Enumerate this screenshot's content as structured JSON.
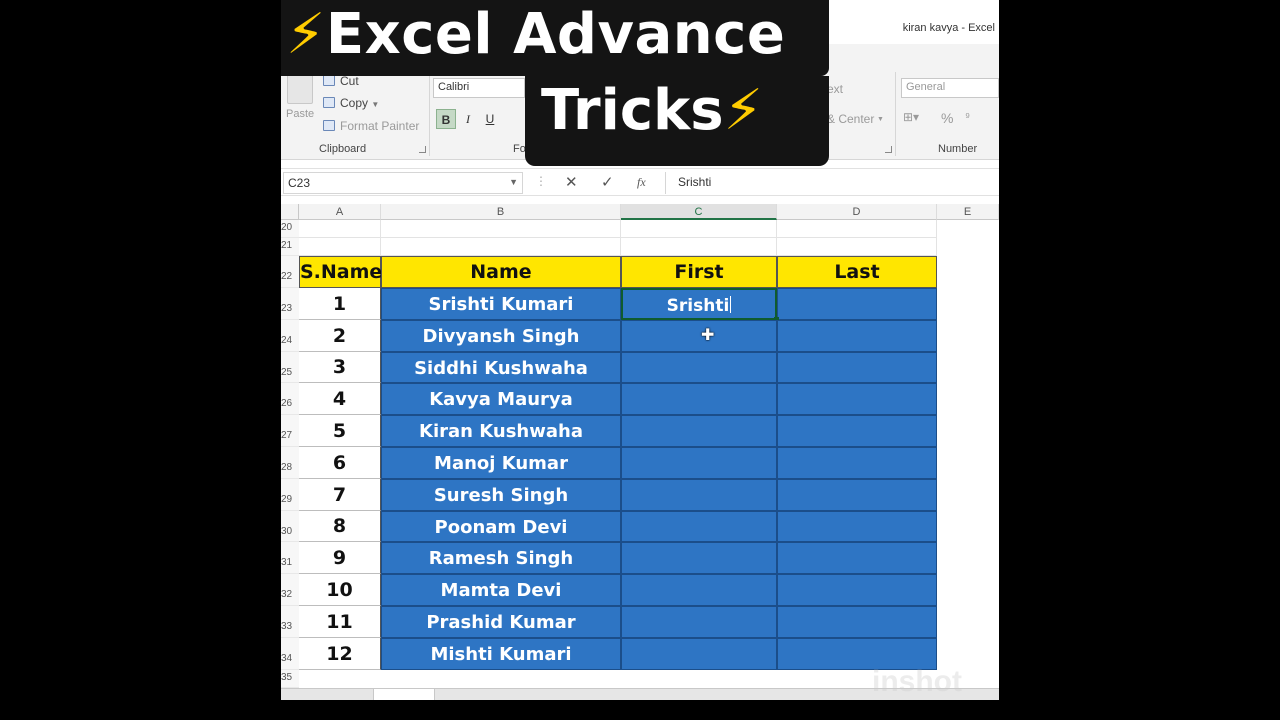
{
  "window": {
    "title": "kiran kavya - Excel"
  },
  "overlay": {
    "line1_icon": "lightning-bolt-icon",
    "line1_text": "Excel Advance",
    "line2_text": "Tricks",
    "line2_icon": "lightning-bolt-icon",
    "bolt_glyph": "⚡",
    "bolt_color": "#ffcc00"
  },
  "ribbon": {
    "clipboard": {
      "paste_label": "Paste",
      "cut_label": "Cut",
      "copy_label": "Copy",
      "format_painter_label": "Format Painter",
      "group_label": "Clipboard"
    },
    "font": {
      "font_name": "Calibri",
      "bold_label": "B",
      "italic_label": "I",
      "underline_label": "U",
      "group_label_partial": "Fo"
    },
    "alignment": {
      "wrap_text_partial": "ext",
      "merge_center_partial": "& Center"
    },
    "number": {
      "format_value": "General",
      "percent_label": "%",
      "group_label": "Number"
    }
  },
  "formula_bar": {
    "name_box": "C23",
    "cancel_glyph": "✕",
    "enter_glyph": "✓",
    "fx_label": "fx",
    "content": "Srishti"
  },
  "grid": {
    "columns": [
      "A",
      "B",
      "C",
      "D",
      "E"
    ],
    "active_column": "C",
    "header_row_number": "22",
    "blank_rows": [
      "20",
      "21"
    ],
    "last_row": "35",
    "headers": {
      "sname": "S.Name",
      "name": "Name",
      "first": "First",
      "last": "Last"
    },
    "rows": [
      {
        "row": "23",
        "sn": "1",
        "name": "Srishti Kumari",
        "first": "Srishti",
        "last": ""
      },
      {
        "row": "24",
        "sn": "2",
        "name": "Divyansh Singh",
        "first": "",
        "last": ""
      },
      {
        "row": "25",
        "sn": "3",
        "name": "Siddhi Kushwaha",
        "first": "",
        "last": ""
      },
      {
        "row": "26",
        "sn": "4",
        "name": "Kavya Maurya",
        "first": "",
        "last": ""
      },
      {
        "row": "27",
        "sn": "5",
        "name": "Kiran Kushwaha",
        "first": "",
        "last": ""
      },
      {
        "row": "28",
        "sn": "6",
        "name": "Manoj Kumar",
        "first": "",
        "last": ""
      },
      {
        "row": "29",
        "sn": "7",
        "name": "Suresh Singh",
        "first": "",
        "last": ""
      },
      {
        "row": "30",
        "sn": "8",
        "name": "Poonam Devi",
        "first": "",
        "last": ""
      },
      {
        "row": "31",
        "sn": "9",
        "name": "Ramesh Singh",
        "first": "",
        "last": ""
      },
      {
        "row": "32",
        "sn": "10",
        "name": "Mamta Devi",
        "first": "",
        "last": ""
      },
      {
        "row": "33",
        "sn": "11",
        "name": "Prashid Kumar",
        "first": "",
        "last": ""
      },
      {
        "row": "34",
        "sn": "12",
        "name": "Mishti Kumari",
        "first": "",
        "last": ""
      }
    ],
    "colors": {
      "header_fill": "#ffe600",
      "data_fill": "#2e75c4",
      "active_border": "#0f5c2e"
    }
  },
  "watermark": "inshot"
}
